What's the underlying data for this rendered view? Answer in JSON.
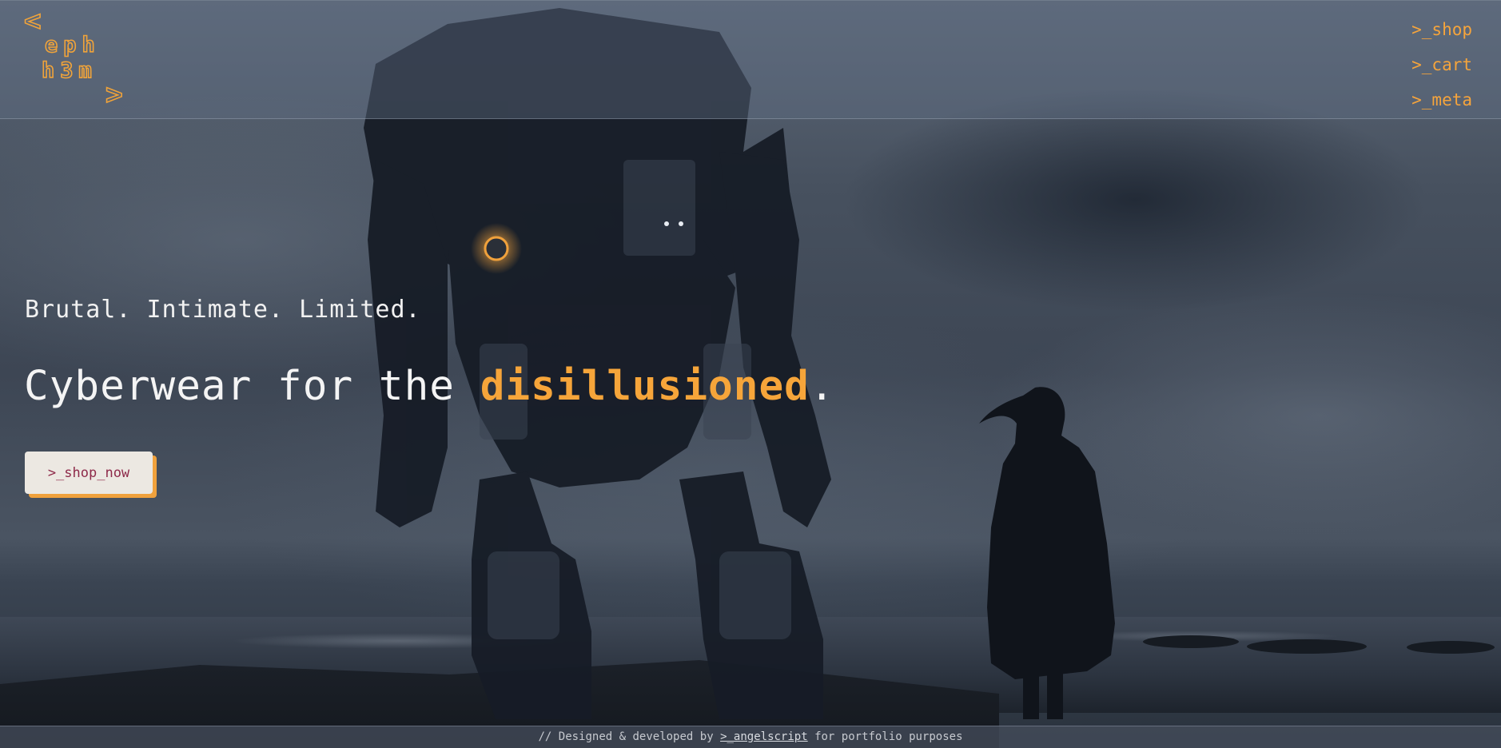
{
  "brand": {
    "logo_line1": "eph",
    "logo_line2": "h3m",
    "logo_left_bracket": "<",
    "logo_right_bracket": ">"
  },
  "nav": {
    "items": [
      {
        "label": ">_shop"
      },
      {
        "label": ">_cart"
      },
      {
        "label": ">_meta"
      }
    ]
  },
  "hero": {
    "tagline": "Brutal. Intimate. Limited.",
    "headline_prefix": "Cyberwear for the ",
    "headline_accent": "disillusioned",
    "headline_suffix": ".",
    "cta_label": ">_shop_now"
  },
  "footer": {
    "prefix": "// Designed & developed by ",
    "link_label": ">_angelscript",
    "suffix": " for portfolio purposes"
  },
  "colors": {
    "accent": "#f5a43c",
    "cta_bg": "#ece8e2",
    "cta_text": "#8e2a4a",
    "headline": "#f4f4f4"
  },
  "images": {
    "hero_background": "robot-and-figure-on-stormy-coast"
  }
}
